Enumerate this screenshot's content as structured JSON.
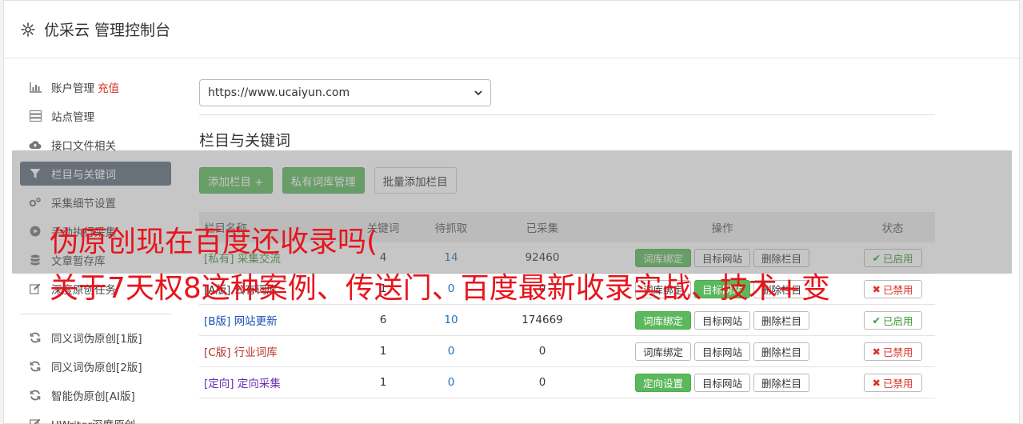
{
  "header": {
    "title": "优采云 管理控制台"
  },
  "sidebar": {
    "items": [
      {
        "label": "账户管理",
        "extra": "充值",
        "icon": "bar-chart-icon"
      },
      {
        "label": "站点管理",
        "icon": "server-icon"
      },
      {
        "label": "接口文件相关",
        "icon": "cloud-upload-icon"
      },
      {
        "label": "栏目与关键词",
        "icon": "filter-icon"
      },
      {
        "label": "采集细节设置",
        "icon": "cogs-icon"
      },
      {
        "label": "手动执行采集",
        "icon": "play-icon"
      },
      {
        "label": "文章暂存库",
        "icon": "database-icon"
      },
      {
        "label": "深度原创任务",
        "icon": "edit-icon"
      },
      {
        "label": "同义词伪原创[1版]",
        "icon": "refresh-icon"
      },
      {
        "label": "同义词伪原创[2版]",
        "icon": "refresh-icon"
      },
      {
        "label": "智能伪原创[AI版]",
        "icon": "refresh-icon"
      },
      {
        "label": "UWriter深度原创",
        "icon": "edit-icon"
      }
    ]
  },
  "main": {
    "site_select": "https://www.ucaiyun.com",
    "section_title": "栏目与关键词",
    "buttons": {
      "add": "添加栏目 +",
      "private": "私有词库管理",
      "batch": "批量添加栏目"
    },
    "table": {
      "headers": [
        "栏目名称",
        "关键词",
        "待抓取",
        "已采集",
        "操作",
        "状态"
      ],
      "rows": [
        {
          "tag": "[私有]",
          "name": "采集交流",
          "keywords": "4",
          "pending": "14",
          "collected": "92460",
          "op1": "词库绑定",
          "op2": "目标网站",
          "op3": "删除栏目",
          "status": "已启用"
        },
        {
          "tag": "[A版]",
          "name": "公有词库",
          "keywords": "1",
          "pending": "0",
          "collected": "0",
          "op1": "词库绑定",
          "op2": "目标网站",
          "op3": "删除栏目",
          "status": "已禁用"
        },
        {
          "tag": "[B版]",
          "name": "网站更新",
          "keywords": "6",
          "pending": "10",
          "collected": "174669",
          "op1": "词库绑定",
          "op2": "目标网站",
          "op3": "删除栏目",
          "status": "已启用"
        },
        {
          "tag": "[C版]",
          "name": "行业词库",
          "keywords": "1",
          "pending": "0",
          "collected": "0",
          "op1": "词库绑定",
          "op2": "目标网站",
          "op3": "删除栏目",
          "status": "已禁用"
        },
        {
          "tag": "[定向]",
          "name": "定向采集",
          "keywords": "1",
          "pending": "0",
          "collected": "0",
          "op1": "定向设置",
          "op2": "目标网站",
          "op3": "删除栏目",
          "status": "已禁用"
        }
      ]
    }
  },
  "overlay": {
    "line1": "伪原创现在百度还收录吗(",
    "line2": "关于7天权8这种案例、传送门、百度最新收录实战、技术+变"
  },
  "colors": {
    "green": "#5cb85c",
    "active_nav": "#5d6b7b",
    "red": "#e8141c"
  }
}
